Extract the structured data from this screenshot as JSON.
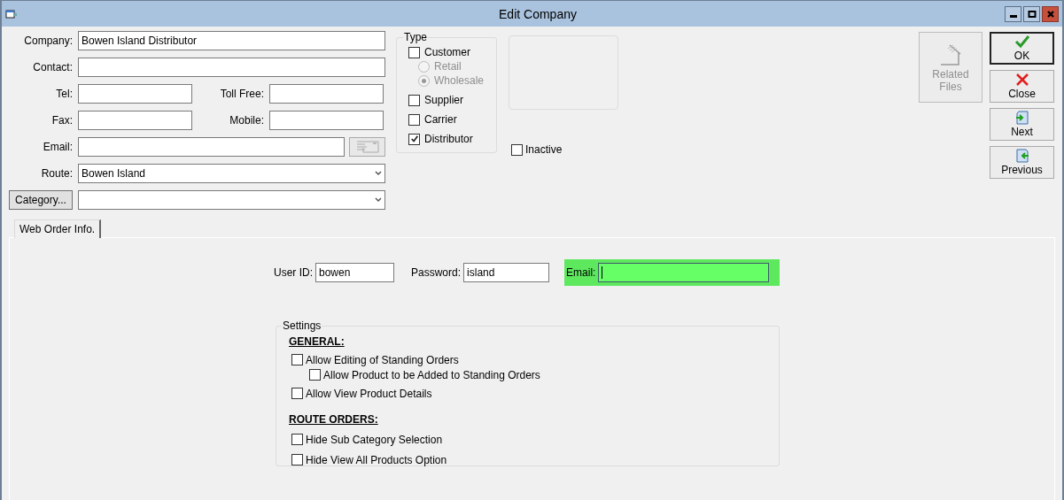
{
  "window": {
    "title": "Edit Company"
  },
  "form": {
    "company": {
      "label": "Company:",
      "value": "Bowen Island Distributor"
    },
    "contact": {
      "label": "Contact:"
    },
    "tel": {
      "label": "Tel:"
    },
    "toll_free": {
      "label": "Toll Free:"
    },
    "fax": {
      "label": "Fax:"
    },
    "mobile": {
      "label": "Mobile:"
    },
    "email": {
      "label": "Email:"
    },
    "route": {
      "label": "Route:",
      "value": "Bowen Island"
    },
    "category": {
      "button": "Category..."
    }
  },
  "type_group": {
    "title": "Type",
    "options": [
      {
        "label": "Customer",
        "kind": "checkbox",
        "checked": false,
        "disabled": false
      },
      {
        "label": "Retail",
        "kind": "radio",
        "selected": false,
        "disabled": true
      },
      {
        "label": "Wholesale",
        "kind": "radio",
        "selected": true,
        "disabled": true
      },
      {
        "label": "Supplier",
        "kind": "checkbox",
        "checked": false,
        "disabled": false
      },
      {
        "label": "Carrier",
        "kind": "checkbox",
        "checked": false,
        "disabled": false
      },
      {
        "label": "Distributor",
        "kind": "checkbox",
        "checked": true,
        "disabled": false
      }
    ]
  },
  "inactive": {
    "label": "Inactive",
    "checked": false
  },
  "related_files": {
    "lines": [
      "Related",
      "Files"
    ],
    "disabled": true
  },
  "actions": [
    {
      "label": "OK",
      "kind": "ok",
      "default": true
    },
    {
      "label": "Close",
      "kind": "close",
      "default": false
    },
    {
      "label": "Next",
      "kind": "next",
      "default": false
    },
    {
      "label": "Previous",
      "kind": "previous",
      "default": false
    }
  ],
  "tabs": [
    {
      "label": "Web Order Info.",
      "selected": true
    }
  ],
  "web_order": {
    "user_id": {
      "label": "User ID:",
      "value": "bowen"
    },
    "password": {
      "label": "Password:",
      "value": "island"
    },
    "email": {
      "label": "Email:",
      "focused": true
    }
  },
  "settings": {
    "title": "Settings",
    "sections": [
      {
        "heading": "GENERAL:",
        "options": [
          {
            "label": "Allow Editing of Standing Orders",
            "checked": false,
            "children": [
              {
                "label": "Allow Product to be Added to Standing Orders",
                "checked": false
              }
            ]
          },
          {
            "label": "Allow View Product Details",
            "checked": false
          }
        ]
      },
      {
        "heading": "ROUTE ORDERS:",
        "options": [
          {
            "label": "Hide Sub Category Selection",
            "checked": false
          },
          {
            "label": "Hide View All Products Option",
            "checked": false
          }
        ]
      }
    ]
  }
}
